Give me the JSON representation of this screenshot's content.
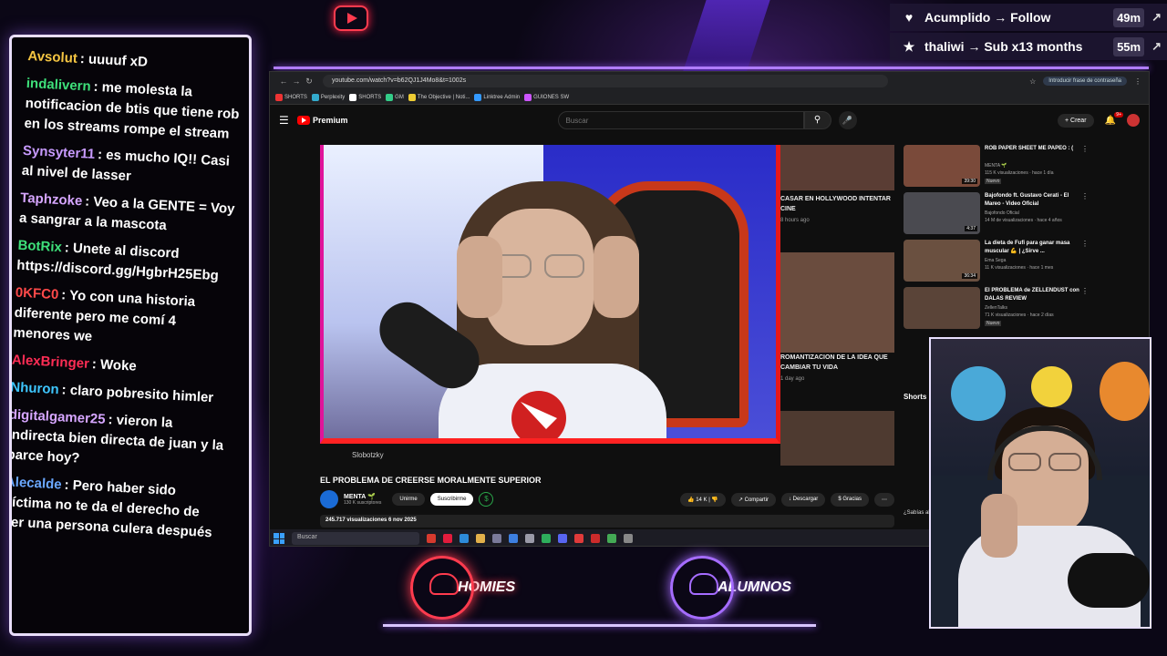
{
  "alerts": [
    {
      "icon": "heart-icon",
      "glyph": "♥",
      "text": "Acumplido → Follow",
      "time": "49m"
    },
    {
      "icon": "star-icon",
      "glyph": "★",
      "text": "thaliwi → Sub x13 months",
      "time": "55m"
    }
  ],
  "chat": [
    {
      "user": "Avsolut",
      "color": "#f5c542",
      "text": ": uuuuf xD"
    },
    {
      "user": "indalivern",
      "color": "#3ee07a",
      "text": ": me molesta la notificacion de btis que tiene rob en los streams rompe el stream"
    },
    {
      "user": "Synsyter11",
      "color": "#c89bff",
      "text": ": es mucho IQ!! Casi al nivel de lasser"
    },
    {
      "user": "Taphzoke",
      "color": "#d6a6ff",
      "text": ": Veo a la GENTE = Voy a sangrar a la mascota"
    },
    {
      "user": "BotRix",
      "color": "#3ee07a",
      "text": ": Unete al discord https://discord.gg/HgbrH25Ebg"
    },
    {
      "user": "0KFC0",
      "color": "#ff4a4a",
      "text": ": Yo con una historia diferente pero me comí 4 menores we"
    },
    {
      "user": "AlexBringer",
      "color": "#ff2d55",
      "text": ": Woke"
    },
    {
      "user": "Nhuron",
      "color": "#3ec7ff",
      "text": ": claro pobresito himler"
    },
    {
      "user": "digitalgamer25",
      "color": "#d6a6ff",
      "text": ": vieron la indirecta bien directa de juan y la parce hoy?"
    },
    {
      "user": "Alecalde",
      "color": "#6aa7ff",
      "text": ": Pero haber sido víctima no te da el derecho de ser una persona culera después"
    }
  ],
  "browser": {
    "url": "youtube.com/watch?v=b62QJ1J4Mo8&t=1002s",
    "password_prompt": "Introducir frase de contraseña",
    "bookmarks": [
      "SHORTS",
      "Perplexity",
      "SHORTS",
      "GM",
      "The Objective | Noti...",
      "Linktree Admin",
      "GUIONES SW"
    ]
  },
  "youtube": {
    "brand": "Premium",
    "search_placeholder": "Buscar",
    "create_label": "Crear",
    "bell_badge": "9+",
    "video_channel_tag": "Slobotzky",
    "video_title": "EL PROBLEMA DE CREERSE MORALMENTE SUPERIOR",
    "channel_name": "MENTA 🌱",
    "channel_subs": "130 K suscriptores",
    "join_label": "Unirme",
    "subscribed_label": "Suscribirme",
    "likes": "14 K",
    "share_label": "Compartir",
    "download_label": "Descargar",
    "thanks_label": "Gracias",
    "views_date": "245.717 visualizaciones  6 nov 2025",
    "recs_in_video": [
      {
        "title": "CASAR EN HOLLYWOOD INTENTAR CINE",
        "meta": "8 hours ago"
      },
      {
        "title": "ROMANTIZACION DE LA IDEA QUE CAMBIAR TU VIDA",
        "meta": "1 day ago"
      }
    ],
    "sidebar": [
      {
        "title": "ROB PAPER SHEET ME PAPEO : (",
        "channel": "MENTA 🌱",
        "meta": "115 K visualizaciones · hace 1 día",
        "badge": "Nuevo",
        "duration": "39:30"
      },
      {
        "title": "Bajofondo ft. Gustavo Cerati - El Mareo - Video Oficial",
        "channel": "Bajofondo Oficial",
        "meta": "14 M de visualizaciones · hace 4 años",
        "badge": "",
        "duration": "4:37"
      },
      {
        "title": "La dieta de Fufi para ganar masa muscular 💪 | ¿Sirve ...",
        "channel": "Ema Sega",
        "meta": "11 K visualizaciones · hace 1 mes",
        "badge": "",
        "duration": "36:34"
      },
      {
        "title": "El PROBLEMA de ZELLENDUST con DALAS REVIEW",
        "channel": "ZellenTalks",
        "meta": "71 K visualizaciones · hace 2 días",
        "badge": "Nuevo",
        "duration": ""
      }
    ],
    "shorts_label": "Shorts",
    "shorts_caption": "¿Sabías ahora lo"
  },
  "taskbar": {
    "search_placeholder": "Buscar"
  },
  "bottom_badges": [
    {
      "label": "HOMIES",
      "color": "#ff3b4e"
    },
    {
      "label": "ALUMNOS",
      "color": "#a56cff"
    }
  ]
}
